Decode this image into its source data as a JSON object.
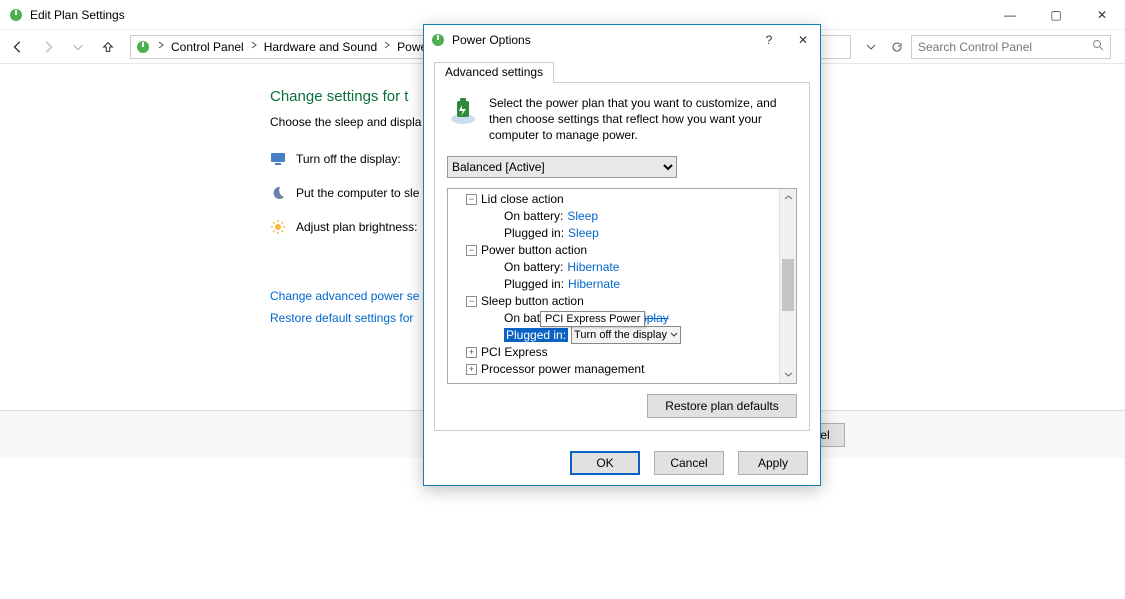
{
  "window": {
    "title": "Edit Plan Settings",
    "minimize_glyph": "—",
    "maximize_glyph": "▢",
    "close_glyph": "✕"
  },
  "breadcrumb": {
    "items": [
      "Control Panel",
      "Hardware and Sound",
      "Power O"
    ]
  },
  "search": {
    "placeholder": "Search Control Panel"
  },
  "page": {
    "heading": "Change settings for t",
    "subheading": "Choose the sleep and displa",
    "row_display": "Turn off the display:",
    "row_sleep": "Put the computer to sle",
    "row_brightness": "Adjust plan brightness:",
    "link_advanced": "Change advanced power se",
    "link_restore": "Restore default settings for",
    "btn_cancel_trunc": "el"
  },
  "dialog": {
    "title": "Power Options",
    "help_glyph": "?",
    "close_glyph": "✕",
    "tab": "Advanced settings",
    "info": "Select the power plan that you want to customize, and then choose settings that reflect how you want your computer to manage power.",
    "plan_selected": "Balanced [Active]",
    "restore_btn": "Restore plan defaults",
    "ok": "OK",
    "cancel": "Cancel",
    "apply": "Apply"
  },
  "tree": {
    "lid": {
      "label": "Lid close action",
      "battery_k": "On battery:",
      "battery_v": "Sleep",
      "plugged_k": "Plugged in:",
      "plugged_v": "Sleep"
    },
    "power": {
      "label": "Power button action",
      "battery_k": "On battery:",
      "battery_v": "Hibernate",
      "plugged_k": "Plugged in:",
      "plugged_v": "Hibernate"
    },
    "sleep": {
      "label": "Sleep button action",
      "battery_k": "On battery:",
      "battery_v": "Turn off the display",
      "plugged_k": "Plugged in:",
      "plugged_v": "Turn off the display"
    },
    "pci": {
      "label": "PCI Express"
    },
    "proc": {
      "label": "Processor power management"
    },
    "tooltip": "PCI Express Power"
  }
}
